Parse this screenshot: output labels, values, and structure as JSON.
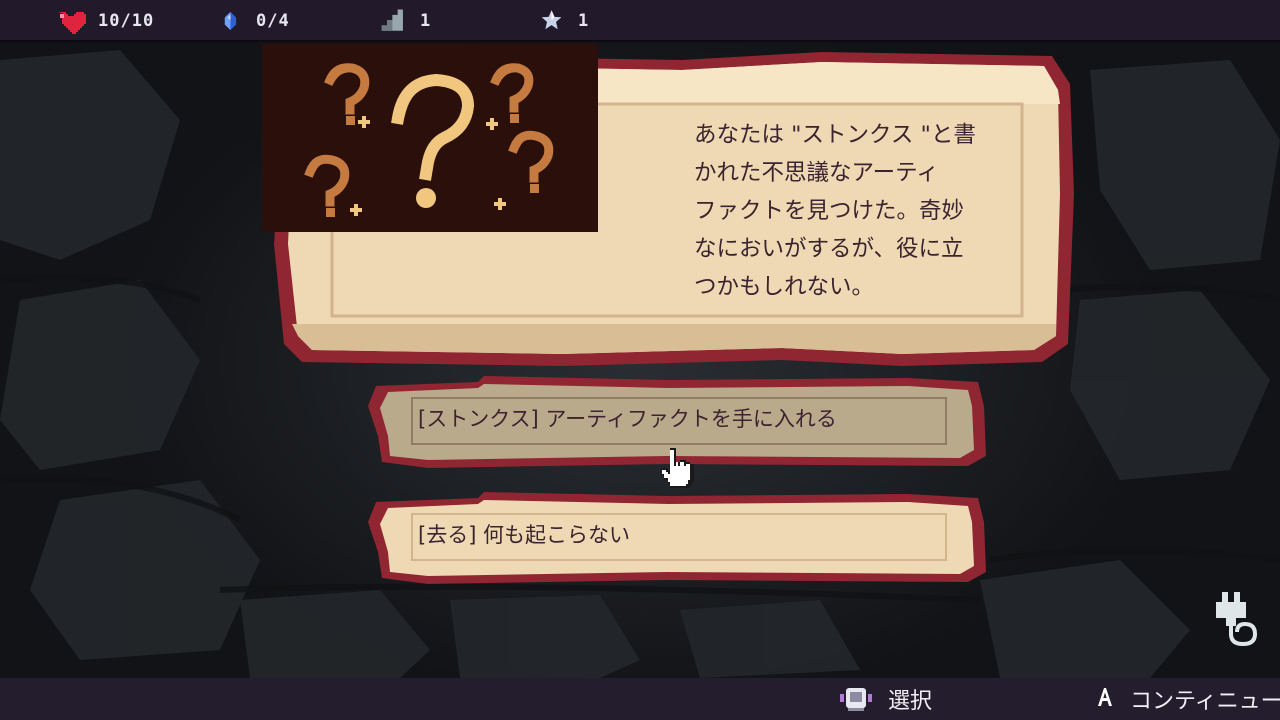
{
  "hud": {
    "health": {
      "icon": "heart-icon",
      "value": "10/10",
      "color": "#e0243d"
    },
    "crystals": {
      "icon": "crystal-icon",
      "value": "0/4",
      "color": "#3b6fe0"
    },
    "floor": {
      "icon": "stairs-icon",
      "value": "1"
    },
    "stars": {
      "icon": "star-icon",
      "value": "1"
    }
  },
  "event": {
    "image_icon": "question-marks-icon",
    "description": "あなたは \"ストンクス \"と書\nかれた不思議なアーティ\nファクトを見つけた。奇妙\nなにおいがするが、役に立\nつかもしれない。"
  },
  "choices": [
    {
      "label": "[ストンクス] アーティファクトを手に入れる",
      "state": "hovered"
    },
    {
      "label": "[去る] 何も起こらない",
      "state": "normal"
    }
  ],
  "cursor": {
    "icon": "hand-pointer-icon"
  },
  "side": {
    "icon": "plug-icon"
  },
  "footer": {
    "select_label": "選択",
    "select_icon": "dpad-icon",
    "continue_label": "コンティニュー",
    "continue_icon": "a-button-icon"
  },
  "colors": {
    "parchment": "#efd9b4",
    "parchment_hover": "#b9aa8c",
    "border_red": "#9a2b35",
    "text": "#3b2430",
    "hud_bg": "#221a2b"
  }
}
